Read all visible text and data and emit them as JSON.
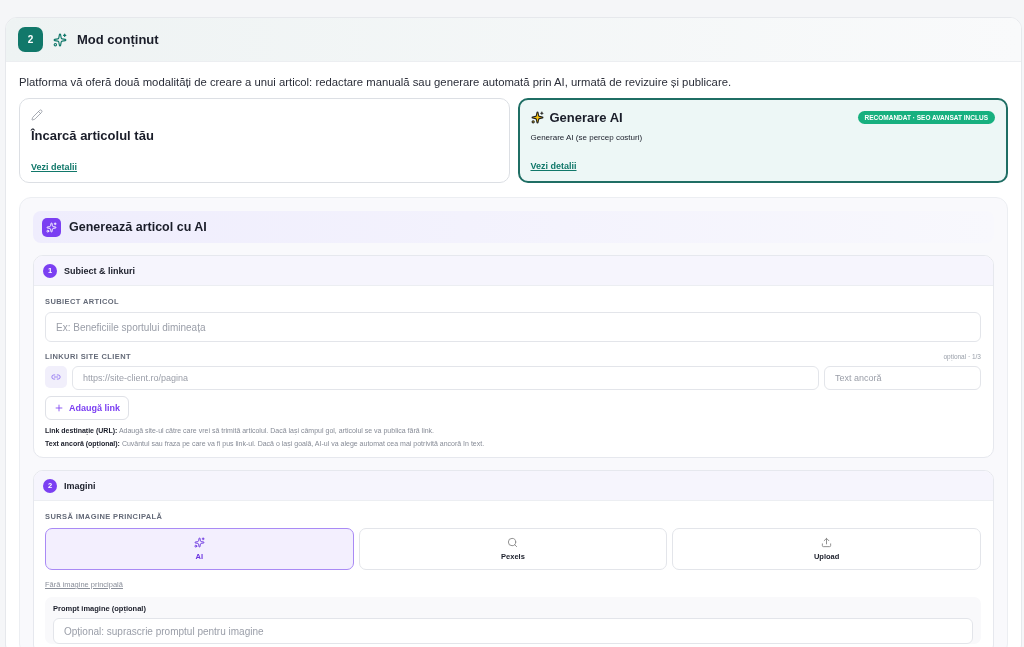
{
  "section": {
    "number": "2",
    "title": "Mod conținut"
  },
  "description": "Platforma vă oferă două modalități de creare a unui articol: redactare manuală sau generare automată prin AI, urmată de revizuire și publicare.",
  "modes": [
    {
      "kind": "manual",
      "title": "Încarcă articolul tău",
      "link": "Vezi detalii",
      "selected": false
    },
    {
      "kind": "ai",
      "title": "Generare AI",
      "subtitle": "Generare AI (se percep costuri)",
      "badge": "RECOMANDAT · SEO AVANSAT INCLUS",
      "link": "Vezi detalii",
      "selected": true
    }
  ],
  "generator": {
    "title": "Generează articol cu AI",
    "topic_step": {
      "number": "1",
      "title": "Subiect & linkuri",
      "subject_label": "SUBIECT ARTICOL",
      "subject_placeholder": "Ex: Beneficiile sportului dimineața",
      "links_label": "LINKURI SITE CLIENT",
      "links_note": "opțional · 1/3",
      "url_placeholder": "https://site-client.ro/pagina",
      "anchor_placeholder": "Text ancoră",
      "add_link": "Adaugă link",
      "hints": [
        "**Link destinație (URL):** Adaugă site-ul către care vrei să trimită articolul. Dacă lași câmpul gol, articolul se va publica fără link.",
        "**Text ancoră (opțional):** Cuvântul sau fraza pe care va fi pus link-ul. Dacă o lași goală, AI-ul va alege automat cea mai potrivită ancoră în text."
      ]
    },
    "image_step": {
      "number": "2",
      "title": "Imagini",
      "source_label": "SURSĂ IMAGINE PRINCIPALĂ",
      "sources": [
        {
          "kind": "ai",
          "label": "AI",
          "selected": true
        },
        {
          "kind": "search",
          "label": "Pexels",
          "selected": false
        },
        {
          "kind": "upload",
          "label": "Upload",
          "selected": false
        }
      ],
      "none_link": "Fără imagine principală",
      "prompt_label": "Prompt imagine (opțional)",
      "prompt_placeholder": "Opțional: suprascrie promptul pentru imagine"
    }
  }
}
